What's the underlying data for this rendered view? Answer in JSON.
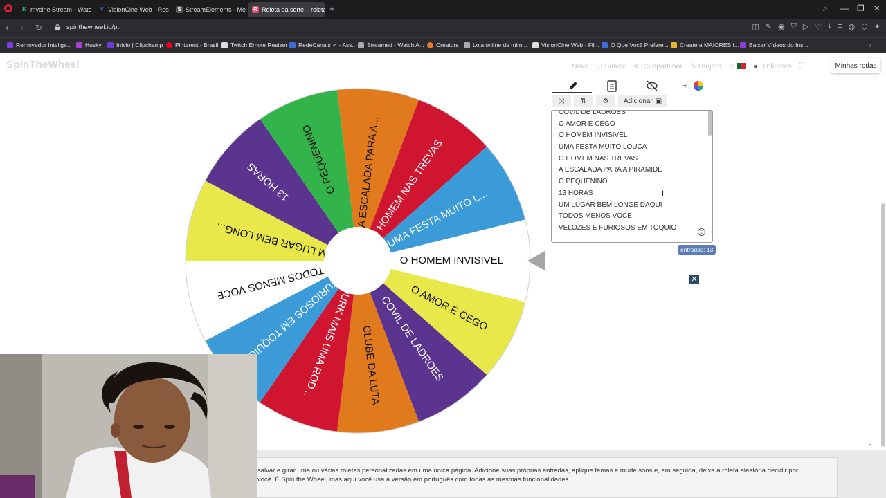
{
  "browser": {
    "tabs": [
      {
        "label": "mvcine Stream - Watch Li",
        "icon_color": "#2ecc71",
        "icon_text": "K"
      },
      {
        "label": "VisionCine Web - Resultac",
        "icon_color": "#3a6fd8",
        "icon_text": "V"
      },
      {
        "label": "StreamElements - Me",
        "icon_color": "#666666",
        "icon_text": "S"
      },
      {
        "label": "Roleta da sorte – roleta c",
        "icon_color": "#e8466b",
        "icon_text": "R",
        "active": true
      }
    ],
    "url": "spinthewheel.io/pt",
    "bookmarks": [
      {
        "label": "Removedor Intelige...",
        "color": "#7b3fe4"
      },
      {
        "label": "Husky",
        "color": "#a43fd6"
      },
      {
        "label": "Início | Clipchamp",
        "color": "#6b3fd6"
      },
      {
        "label": "Pinterest - Brasil",
        "color": "#e60023"
      },
      {
        "label": "Twitch Emote Resizer",
        "color": "#e0e0e0"
      },
      {
        "label": "RedeCanais ✓ - Ass...",
        "color": "#3a6fd8"
      },
      {
        "label": "Streamed - Watch A...",
        "color": "#aaaaaa"
      },
      {
        "label": "Creators",
        "color": "#e87b2b"
      },
      {
        "label": "Loja online de mlm...",
        "color": "#aaaaaa"
      },
      {
        "label": "VisionCine Web - Fil...",
        "color": "#e0e0e0"
      },
      {
        "label": "O Que Você Prefere...",
        "color": "#3a6fd8"
      },
      {
        "label": "Create a MAIORES I...",
        "color": "#e8b42b"
      },
      {
        "label": "Baixar Vídeos do Ins...",
        "color": "#8b3fd6"
      }
    ]
  },
  "site": {
    "logo": "SpinTheWheel",
    "menu": {
      "new": "Novo",
      "save": "Salvar",
      "share": "Compartilhar",
      "project": "Projeto",
      "lang": "pt",
      "library": "Biblioteca"
    },
    "my_wheels": "Minhas rodas"
  },
  "wheel": {
    "segments": [
      {
        "label": "O HOMEM INVISIVEL",
        "color": "#ffffff",
        "text_color": "#111111"
      },
      {
        "label": "O AMOR É CEGO",
        "color": "#e8e84a",
        "text_color": "#111111"
      },
      {
        "label": "COVIL DE LADROES",
        "color": "#5b3490",
        "text_color": "#ffffff"
      },
      {
        "label": "CLUBE DA LUTA",
        "color": "#e07a1c",
        "text_color": "#111111"
      },
      {
        "label": "DURK MAIS UMA ROD...",
        "color": "#cf1530",
        "text_color": "#ffffff"
      },
      {
        "label": "VELOZES E FURIOSOS EM TOQUIO",
        "color": "#3a9bd8",
        "text_color": "#ffffff"
      },
      {
        "label": "TODOS MENOS VOCE",
        "color": "#ffffff",
        "text_color": "#111111"
      },
      {
        "label": "UM LUGAR BEM LONG...",
        "color": "#e8e84a",
        "text_color": "#111111"
      },
      {
        "label": "13 HORAS",
        "color": "#5b3490",
        "text_color": "#ffffff"
      },
      {
        "label": "O PEQUENINO",
        "color": "#33b44a",
        "text_color": "#111111"
      },
      {
        "label": "A ESCALADA PARA A...",
        "color": "#e07a1c",
        "text_color": "#111111"
      },
      {
        "label": "O HOMEM NAS TREVAS",
        "color": "#cf1530",
        "text_color": "#ffffff"
      },
      {
        "label": "UMA FESTA MUITO L...",
        "color": "#3a9bd8",
        "text_color": "#ffffff"
      }
    ]
  },
  "editor": {
    "add_label": "Adicionar",
    "entries": [
      "COVIL DE LADROES",
      "O AMOR É CEGO",
      "O HOMEM INVISIVEL",
      "UMA FESTA MUITO LOUCA",
      "O HOMEM NAS TREVAS",
      "A ESCALADA PARA A PIRAMIDE",
      "O PEQUENINO",
      "13 HORAS",
      "UM LUGAR BEM LONGE DAQUI",
      "TODOS MENOS VOCE",
      "VELOZES E FURIOSOS EM TOQUIO"
    ],
    "entries_count": "entradas: 13"
  },
  "description": "salvar e girar uma ou várias roletas personalizadas em uma única página. Adicione suas próprias entradas, aplique temas e mude sons e, em seguida, deixe a roleta aleatória decidir por você. É Spin the Wheel, mas aqui você usa a versão em português com todas as mesmas funcionalidades."
}
